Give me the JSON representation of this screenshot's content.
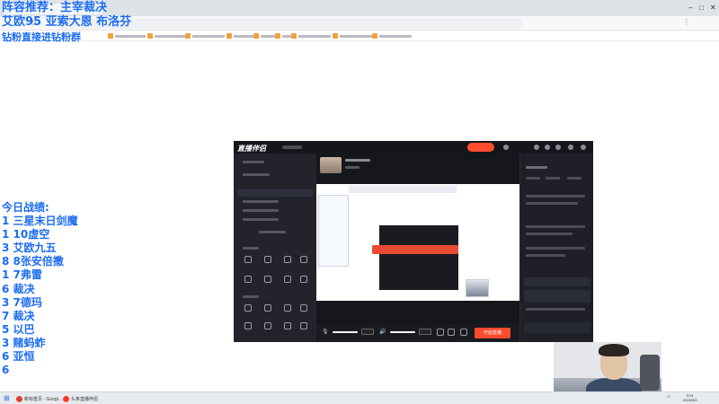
{
  "overlay": {
    "lineup": "阵容推荐：主宰裁决",
    "players": "艾欧95 亚索大恩 布洛芬",
    "fan_group": "钻粉直接进钻粉群"
  },
  "stats": {
    "title": "今日战绩:",
    "items": [
      "1 三星末日剑魔",
      "1 10虚空",
      "3 艾欧九五",
      "8 8张安倍撒",
      "1 7弗雷",
      "6 裁决",
      "3 7德玛",
      "7 裁决",
      "5 以巴",
      "3 赌蚂蚱",
      "6 亚恒",
      "6"
    ]
  },
  "app": {
    "title": "直播伴侣",
    "start_button": "开始直播"
  },
  "taskbar": {
    "items": [
      {
        "label": "新标签页 - Googl...",
        "icon": "chrome-icon",
        "color": "#e34133"
      },
      {
        "label": "头条直播伴侣",
        "icon": "douyin-icon",
        "color": "#ff3b2f"
      }
    ],
    "time": "9:01",
    "date": "2024/3/2"
  },
  "colors": {
    "overlay_text": "#1b6cf2",
    "accent": "#ff4b2e",
    "app_bg": "#1d1e25"
  }
}
